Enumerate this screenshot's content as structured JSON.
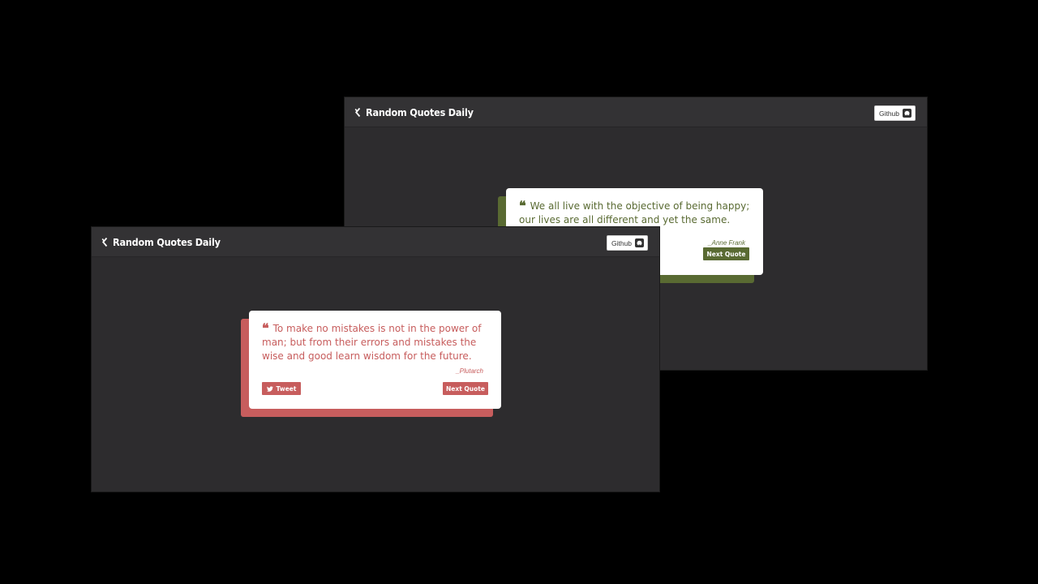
{
  "screens": [
    {
      "id": "back",
      "brand": "Random Quotes Daily",
      "github_label": "Github",
      "theme_color": "#596a32",
      "quote": "We all live with the objective of being happy; our lives are all different and yet the same.",
      "author": "_Anne Frank",
      "next_label": "Next Quote"
    },
    {
      "id": "front",
      "brand": "Random Quotes Daily",
      "github_label": "Github",
      "theme_color": "#c75d5d",
      "quote": "To make no mistakes is not in the power of man; but from their errors and mistakes the wise and good learn wisdom for the future.",
      "author": "_Plutarch",
      "tweet_label": "Tweet",
      "next_label": "Next Quote"
    }
  ],
  "icons": {
    "brand": "freecodecamp-icon",
    "github": "github-icon",
    "quote": "quote-left-icon",
    "tweet": "twitter-icon"
  }
}
